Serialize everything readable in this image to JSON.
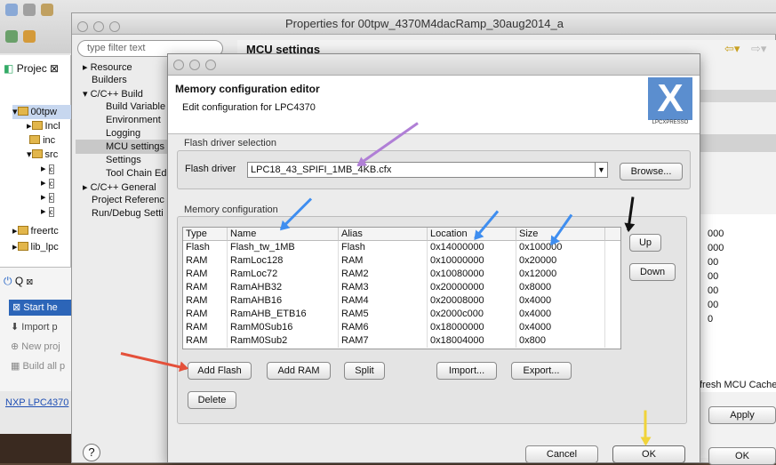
{
  "ide": {
    "project_tab": "Projec",
    "tree": [
      "00tpw",
      "Incl",
      "inc",
      "src",
      "freertc",
      "lib_lpc"
    ],
    "quickstart_tab": "Q",
    "quickstart_items": [
      "Start he",
      "Import p",
      "New proj",
      "Build all p"
    ],
    "status_link": "NXP LPC4370",
    "right_values": [
      "000",
      "000",
      "00",
      "00",
      "00",
      "00",
      "0"
    ],
    "refresh_label": "fresh MCU Cache",
    "apply_label": "Apply",
    "ok_label": "OK",
    "help_glyph": "?"
  },
  "properties": {
    "title": "Properties for 00tpw_4370M4dacRamp_30aug2014_a",
    "filter_placeholder": "type filter text",
    "page_title": "MCU settings",
    "nav": [
      "Resource",
      "Builders",
      "C/C++ Build",
      "Build Variable",
      "Environment",
      "Logging",
      "MCU settings",
      "Settings",
      "Tool Chain Ed",
      "C/C++ General",
      "Project Referenc",
      "Run/Debug Setti"
    ]
  },
  "dialog": {
    "title": "Memory configuration editor",
    "subtitle": "Edit configuration for LPC4370",
    "logo_text": "LPCXPRESSO",
    "flash_group_label": "Flash driver selection",
    "flash_driver_label": "Flash driver",
    "flash_driver_value": "LPC18_43_SPIFI_1MB_4KB.cfx",
    "browse_label": "Browse...",
    "memory_group_label": "Memory configuration",
    "columns": [
      "Type",
      "Name",
      "Alias",
      "Location",
      "Size"
    ],
    "rows": [
      [
        "Flash",
        "Flash_tw_1MB",
        "Flash",
        "0x14000000",
        "0x100000"
      ],
      [
        "RAM",
        "RamLoc128",
        "RAM",
        "0x10000000",
        "0x20000"
      ],
      [
        "RAM",
        "RamLoc72",
        "RAM2",
        "0x10080000",
        "0x12000"
      ],
      [
        "RAM",
        "RamAHB32",
        "RAM3",
        "0x20000000",
        "0x8000"
      ],
      [
        "RAM",
        "RamAHB16",
        "RAM4",
        "0x20008000",
        "0x4000"
      ],
      [
        "RAM",
        "RamAHB_ETB16",
        "RAM5",
        "0x2000c000",
        "0x4000"
      ],
      [
        "RAM",
        "RamM0Sub16",
        "RAM6",
        "0x18000000",
        "0x4000"
      ],
      [
        "RAM",
        "RamM0Sub2",
        "RAM7",
        "0x18004000",
        "0x800"
      ]
    ],
    "up_label": "Up",
    "down_label": "Down",
    "add_flash_label": "Add Flash",
    "add_ram_label": "Add RAM",
    "split_label": "Split",
    "import_label": "Import...",
    "export_label": "Export...",
    "delete_label": "Delete",
    "cancel_label": "Cancel",
    "ok_label": "OK"
  },
  "annotation_colors": {
    "purple": "#b07fd6",
    "blue": "#3f8ef0",
    "black": "#111111",
    "red": "#e4503a",
    "yellow": "#f0d33a"
  }
}
